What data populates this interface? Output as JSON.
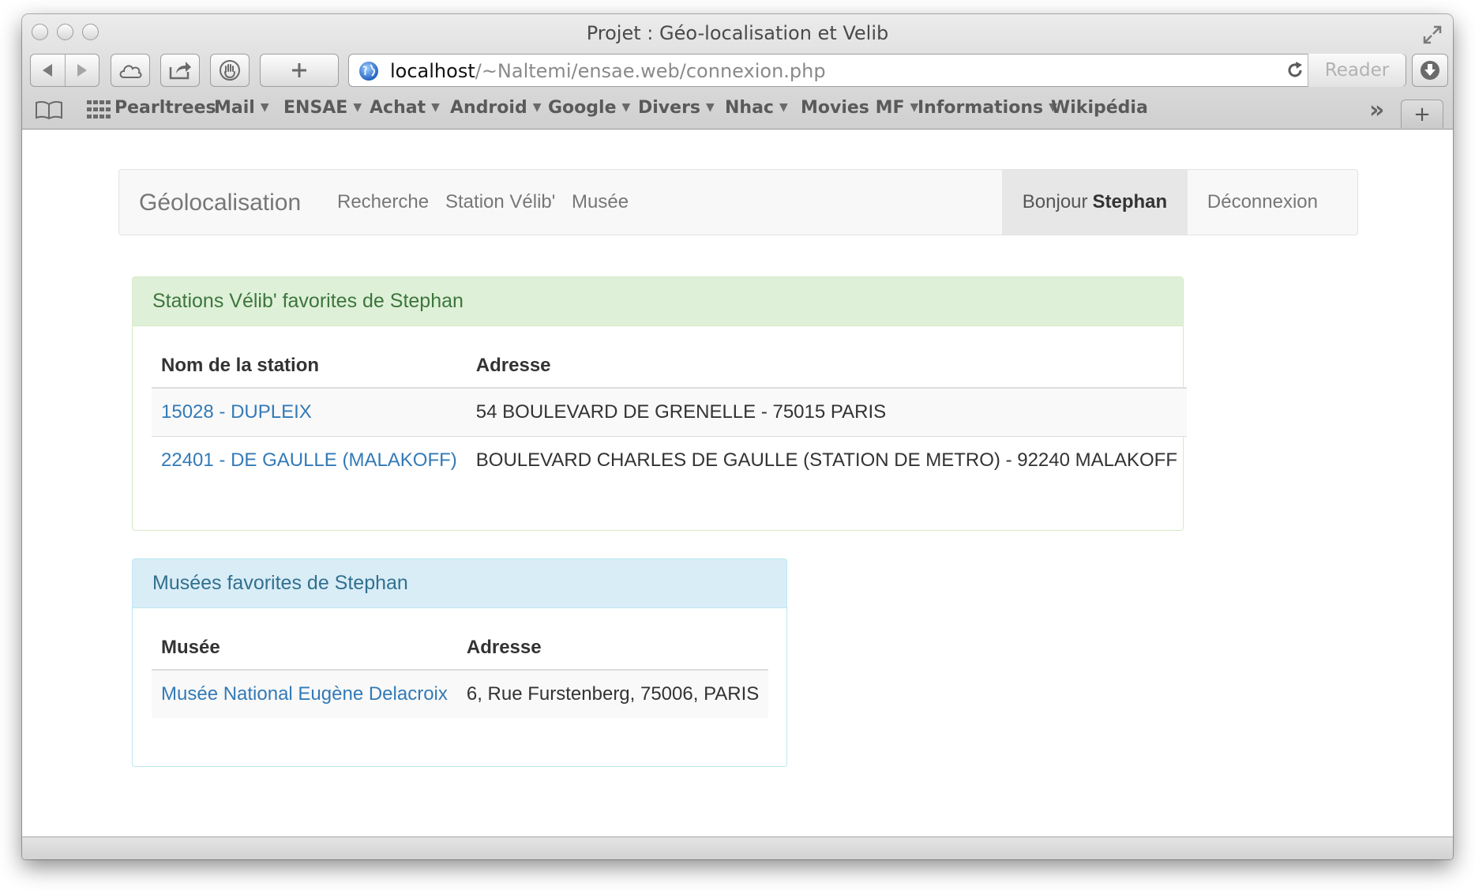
{
  "window": {
    "title": "Projet : Géo-localisation et Velib"
  },
  "toolbar": {
    "url_host": "localhost",
    "url_path": "/~Naltemi/ensae.web/connexion.php",
    "reader_label": "Reader",
    "icons": [
      "back-icon",
      "forward-icon",
      "cloud-icon",
      "share-icon",
      "hand-icon",
      "plus-icon",
      "globe-icon",
      "reload-icon",
      "download-icon"
    ]
  },
  "bookmarks": {
    "items": [
      {
        "label": "Pearltrees",
        "menu": false
      },
      {
        "label": "Mail",
        "menu": true
      },
      {
        "label": "ENSAE",
        "menu": true
      },
      {
        "label": "Achat",
        "menu": true
      },
      {
        "label": "Android",
        "menu": true
      },
      {
        "label": "Google",
        "menu": true
      },
      {
        "label": "Divers",
        "menu": true
      },
      {
        "label": "Nhac",
        "menu": true
      },
      {
        "label": "Movies MF",
        "menu": true
      },
      {
        "label": "Informations",
        "menu": true
      },
      {
        "label": "Wikipédia",
        "menu": false
      }
    ],
    "overflow_label": "»",
    "newtab_label": "+"
  },
  "navbar": {
    "brand": "Géolocalisation",
    "links": [
      "Recherche",
      "Station Vélib'",
      "Musée"
    ],
    "greeting_prefix": "Bonjour",
    "user": "Stephan",
    "logout": "Déconnexion"
  },
  "velib_panel": {
    "heading": "Stations Vélib' favorites de Stephan",
    "columns": [
      "Nom de la station",
      "Adresse"
    ],
    "rows": [
      {
        "name": "15028 - DUPLEIX",
        "address": "54 BOULEVARD DE GRENELLE - 75015 PARIS"
      },
      {
        "name": "22401 - DE GAULLE (MALAKOFF)",
        "address": "BOULEVARD CHARLES DE GAULLE (STATION DE METRO) - 92240 MALAKOFF"
      }
    ]
  },
  "museum_panel": {
    "heading": "Musées favorites de Stephan",
    "columns": [
      "Musée",
      "Adresse"
    ],
    "rows": [
      {
        "name": "Musée National Eugène Delacroix",
        "address": "6, Rue Furstenberg, 75006, PARIS"
      }
    ]
  },
  "colors": {
    "link": "#337ab7",
    "success_bg": "#dff0d8",
    "success_text": "#3c763d",
    "info_bg": "#d9edf7",
    "info_text": "#31708f",
    "navbar_bg": "#f8f8f8"
  }
}
